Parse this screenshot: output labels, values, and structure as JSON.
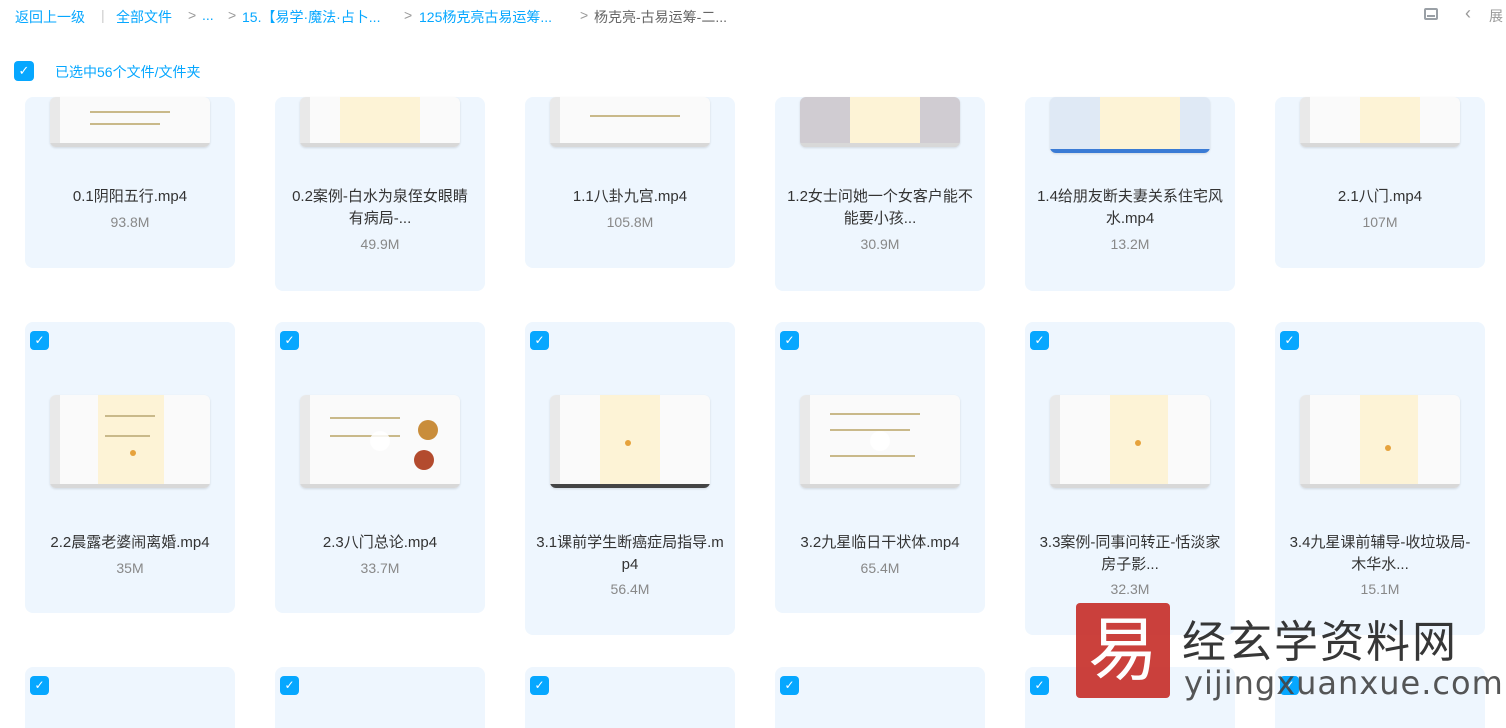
{
  "breadcrumb": {
    "back": "返回上一级",
    "all_files": "全部文件",
    "ellipsis": "...",
    "level1": "15.【易学·魔法·占卜...",
    "level2": "125杨克亮古易运筹...",
    "current": "杨克亮-古易运筹-二...",
    "sep": ">",
    "pipe": "|"
  },
  "toolbar": {
    "collapse_icon": "‹",
    "expand_label": "展"
  },
  "selection": {
    "check": "✓",
    "text": "已选中56个文件/文件夹"
  },
  "files_row1": [
    {
      "name": "0.1阴阳五行.mp4",
      "size": "93.8M"
    },
    {
      "name": "0.2案例-白水为泉侄女眼睛有病局-...",
      "size": "49.9M"
    },
    {
      "name": "1.1八卦九宫.mp4",
      "size": "105.8M"
    },
    {
      "name": "1.2女士问她一个女客户能不能要小孩...",
      "size": "30.9M"
    },
    {
      "name": "1.4给朋友断夫妻关系住宅风水.mp4",
      "size": "13.2M"
    },
    {
      "name": "2.1八门.mp4",
      "size": "107M"
    }
  ],
  "files_row2": [
    {
      "name": "2.2晨露老婆闹离婚.mp4",
      "size": "35M"
    },
    {
      "name": "2.3八门总论.mp4",
      "size": "33.7M"
    },
    {
      "name": "3.1课前学生断癌症局指导.mp4",
      "size": "56.4M"
    },
    {
      "name": "3.2九星临日干状体.mp4",
      "size": "65.4M"
    },
    {
      "name": "3.3案例-同事问转正-恬淡家房子影...",
      "size": "32.3M"
    },
    {
      "name": "3.4九星课前辅导-收垃圾局-木华水...",
      "size": "15.1M"
    }
  ],
  "watermark": {
    "logo_char": "易",
    "title": "经玄学资料网",
    "url": "yijingxuanxue.com"
  }
}
